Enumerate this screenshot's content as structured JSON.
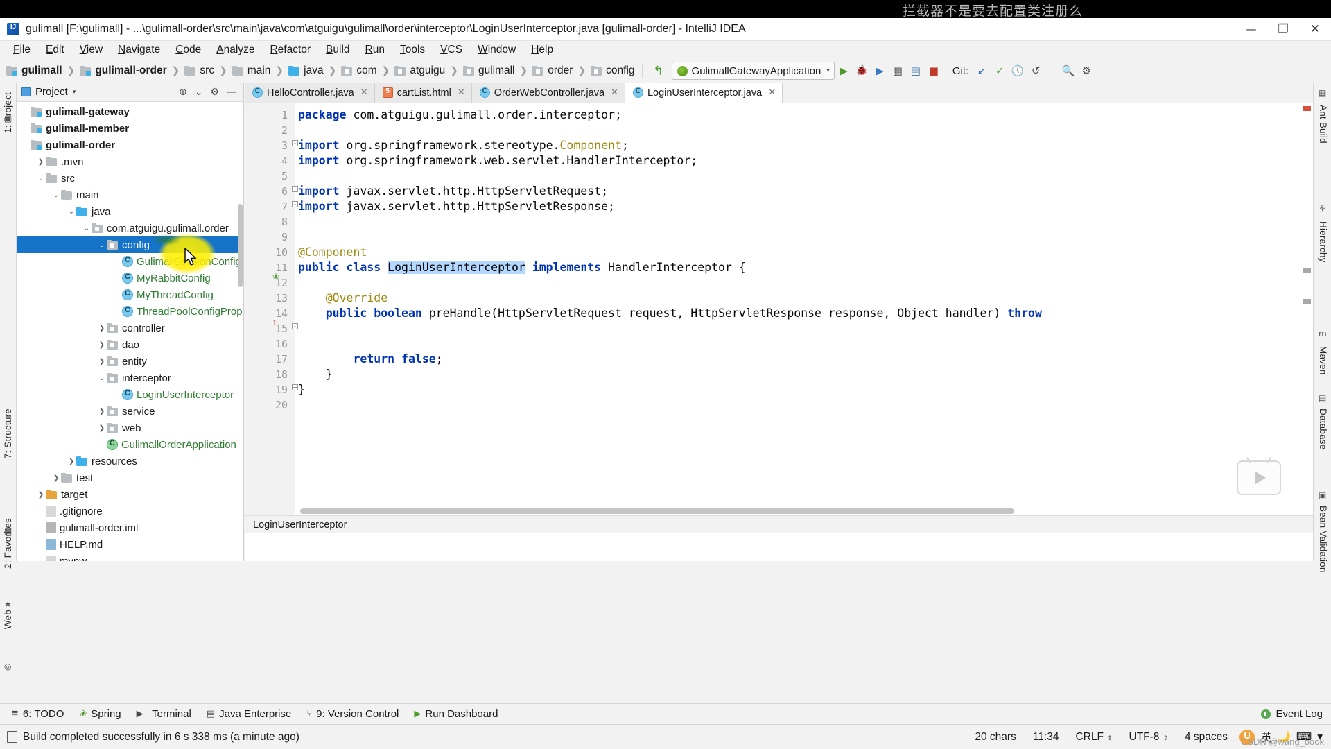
{
  "annotation": {
    "text": "拦截器不是要去配置类注册么"
  },
  "titlebar": {
    "logo_icon": "intellij-idea-logo",
    "title": "gulimall [F:\\gulimall] - ...\\gulimall-order\\src\\main\\java\\com\\atguigu\\gulimall\\order\\interceptor\\LoginUserInterceptor.java [gulimall-order] - IntelliJ IDEA",
    "minimize": "—",
    "maximize": "❐",
    "close": "✕"
  },
  "menubar": {
    "items": [
      "File",
      "Edit",
      "View",
      "Navigate",
      "Code",
      "Analyze",
      "Refactor",
      "Build",
      "Run",
      "Tools",
      "VCS",
      "Window",
      "Help"
    ]
  },
  "navbar": {
    "breadcrumbs": [
      {
        "label": "gulimall",
        "icon": "module-folder-icon",
        "bold": true
      },
      {
        "label": "gulimall-order",
        "icon": "module-folder-icon",
        "bold": true
      },
      {
        "label": "src",
        "icon": "folder-icon",
        "bold": false
      },
      {
        "label": "main",
        "icon": "folder-icon",
        "bold": false
      },
      {
        "label": "java",
        "icon": "source-folder-icon",
        "bold": false
      },
      {
        "label": "com",
        "icon": "package-icon",
        "bold": false
      },
      {
        "label": "atguigu",
        "icon": "package-icon",
        "bold": false
      },
      {
        "label": "gulimall",
        "icon": "package-icon",
        "bold": false
      },
      {
        "label": "order",
        "icon": "package-icon",
        "bold": false
      },
      {
        "label": "config",
        "icon": "package-icon",
        "bold": false
      }
    ],
    "separator": "❯",
    "run_config": {
      "name": "GulimallGatewayApplication",
      "icon": "spring-boot-icon",
      "arrow": "▾"
    },
    "buttons": [
      "run-button",
      "debug-button",
      "run-with-coverage-button",
      "profile-button",
      "build-button",
      "stop-button"
    ],
    "git_label": "Git:"
  },
  "left_strip": {
    "tabs": [
      {
        "label": "1: Project",
        "icon": "project-icon"
      },
      {
        "label": "7: Structure",
        "icon": "structure-icon"
      },
      {
        "label": "2: Favorites",
        "icon": "favorites-icon"
      },
      {
        "label": "Web",
        "icon": "web-icon"
      }
    ]
  },
  "right_strip": {
    "tabs": [
      {
        "label": "Ant Build",
        "icon": "ant-icon"
      },
      {
        "label": "Hierarchy",
        "icon": "hierarchy-icon"
      },
      {
        "label": "Maven",
        "icon": "maven-icon"
      },
      {
        "label": "Database",
        "icon": "database-icon"
      },
      {
        "label": "Bean Validation",
        "icon": "bean-validation-icon"
      }
    ]
  },
  "project_panel": {
    "title": "Project",
    "caret": "▾",
    "icons": [
      "locate-icon",
      "collapse-all-icon",
      "settings-icon",
      "hide-icon"
    ],
    "tree": [
      {
        "label": "gulimall-gateway",
        "indent": 0,
        "arrow": "",
        "icon": "module-folder-icon",
        "bold": true,
        "style": "plain",
        "selected": false
      },
      {
        "label": "gulimall-member",
        "indent": 0,
        "arrow": "",
        "icon": "module-folder-icon",
        "bold": true,
        "style": "plain",
        "selected": false
      },
      {
        "label": "gulimall-order",
        "indent": 0,
        "arrow": "",
        "icon": "module-folder-icon",
        "bold": true,
        "style": "plain",
        "selected": false
      },
      {
        "label": ".mvn",
        "indent": 1,
        "arrow": "❯",
        "icon": "folder-icon",
        "bold": false,
        "style": "plain",
        "selected": false
      },
      {
        "label": "src",
        "indent": 1,
        "arrow": "⌄",
        "icon": "folder-icon",
        "bold": false,
        "style": "plain",
        "selected": false
      },
      {
        "label": "main",
        "indent": 2,
        "arrow": "⌄",
        "icon": "folder-icon",
        "bold": false,
        "style": "plain",
        "selected": false
      },
      {
        "label": "java",
        "indent": 3,
        "arrow": "⌄",
        "icon": "source-folder-icon",
        "bold": false,
        "style": "plain",
        "selected": false
      },
      {
        "label": "com.atguigu.gulimall.order",
        "indent": 4,
        "arrow": "⌄",
        "icon": "package-icon",
        "bold": false,
        "style": "plain",
        "selected": false
      },
      {
        "label": "config",
        "indent": 5,
        "arrow": "⌄",
        "icon": "package-icon",
        "bold": false,
        "style": "plain",
        "selected": true
      },
      {
        "label": "GulimallSessionConfig",
        "indent": 6,
        "arrow": "",
        "icon": "java-class-icon",
        "bold": false,
        "style": "java",
        "selected": false
      },
      {
        "label": "MyRabbitConfig",
        "indent": 6,
        "arrow": "",
        "icon": "java-class-icon",
        "bold": false,
        "style": "java",
        "selected": false
      },
      {
        "label": "MyThreadConfig",
        "indent": 6,
        "arrow": "",
        "icon": "java-class-icon",
        "bold": false,
        "style": "java",
        "selected": false
      },
      {
        "label": "ThreadPoolConfigPrope",
        "indent": 6,
        "arrow": "",
        "icon": "java-class-icon",
        "bold": false,
        "style": "java",
        "selected": false
      },
      {
        "label": "controller",
        "indent": 5,
        "arrow": "❯",
        "icon": "package-icon",
        "bold": false,
        "style": "plain",
        "selected": false
      },
      {
        "label": "dao",
        "indent": 5,
        "arrow": "❯",
        "icon": "package-icon",
        "bold": false,
        "style": "plain",
        "selected": false
      },
      {
        "label": "entity",
        "indent": 5,
        "arrow": "❯",
        "icon": "package-icon",
        "bold": false,
        "style": "plain",
        "selected": false
      },
      {
        "label": "interceptor",
        "indent": 5,
        "arrow": "⌄",
        "icon": "package-icon",
        "bold": false,
        "style": "plain",
        "selected": false
      },
      {
        "label": "LoginUserInterceptor",
        "indent": 6,
        "arrow": "",
        "icon": "java-class-icon",
        "bold": false,
        "style": "java",
        "selected": false
      },
      {
        "label": "service",
        "indent": 5,
        "arrow": "❯",
        "icon": "package-icon",
        "bold": false,
        "style": "plain",
        "selected": false
      },
      {
        "label": "web",
        "indent": 5,
        "arrow": "❯",
        "icon": "package-icon",
        "bold": false,
        "style": "plain",
        "selected": false
      },
      {
        "label": "GulimallOrderApplication",
        "indent": 5,
        "arrow": "",
        "icon": "spring-class-icon",
        "bold": false,
        "style": "java",
        "selected": false
      },
      {
        "label": "resources",
        "indent": 3,
        "arrow": "❯",
        "icon": "resource-folder-icon",
        "bold": false,
        "style": "plain",
        "selected": false
      },
      {
        "label": "test",
        "indent": 2,
        "arrow": "❯",
        "icon": "folder-icon",
        "bold": false,
        "style": "plain",
        "selected": false
      },
      {
        "label": "target",
        "indent": 1,
        "arrow": "❯",
        "icon": "target-folder-icon",
        "bold": false,
        "style": "orange",
        "selected": false
      },
      {
        "label": ".gitignore",
        "indent": 1,
        "arrow": "",
        "icon": "file-icon",
        "bold": false,
        "style": "plain",
        "selected": false
      },
      {
        "label": "gulimall-order.iml",
        "indent": 1,
        "arrow": "",
        "icon": "iml-file-icon",
        "bold": false,
        "style": "plain",
        "selected": false
      },
      {
        "label": "HELP.md",
        "indent": 1,
        "arrow": "",
        "icon": "markdown-file-icon",
        "bold": false,
        "style": "plain",
        "selected": false
      },
      {
        "label": "mvnw",
        "indent": 1,
        "arrow": "",
        "icon": "file-icon",
        "bold": false,
        "style": "plain",
        "selected": false
      }
    ]
  },
  "editor": {
    "tabs": [
      {
        "label": "HelloController.java",
        "icon": "java-class-icon",
        "active": false,
        "close": "✕"
      },
      {
        "label": "cartList.html",
        "icon": "html-file-icon",
        "active": false,
        "close": "✕"
      },
      {
        "label": "OrderWebController.java",
        "icon": "java-class-icon",
        "active": false,
        "close": "✕"
      },
      {
        "label": "LoginUserInterceptor.java",
        "icon": "java-class-icon",
        "active": true,
        "close": "✕"
      }
    ],
    "line_numbers": [
      "1",
      "2",
      "3",
      "4",
      "5",
      "6",
      "7",
      "8",
      "9",
      "10",
      "11",
      "12",
      "13",
      "14",
      "15",
      "16",
      "17",
      "18",
      "19",
      "20"
    ],
    "code_lines": [
      {
        "n": 1,
        "segments": [
          {
            "t": "package ",
            "c": "kw"
          },
          {
            "t": "com.atguigu.gulimall.order.interceptor;",
            "c": "pln"
          }
        ]
      },
      {
        "n": 2,
        "segments": []
      },
      {
        "n": 3,
        "segments": [
          {
            "t": "import ",
            "c": "kw"
          },
          {
            "t": "org.springframework.stereotype.",
            "c": "pln"
          },
          {
            "t": "Component",
            "c": "ann"
          },
          {
            "t": ";",
            "c": "pln"
          }
        ]
      },
      {
        "n": 4,
        "segments": [
          {
            "t": "import ",
            "c": "kw"
          },
          {
            "t": "org.springframework.web.servlet.HandlerInterceptor;",
            "c": "pln"
          }
        ]
      },
      {
        "n": 5,
        "segments": []
      },
      {
        "n": 6,
        "segments": [
          {
            "t": "import ",
            "c": "kw"
          },
          {
            "t": "javax.servlet.http.HttpServletRequest;",
            "c": "pln"
          }
        ]
      },
      {
        "n": 7,
        "segments": [
          {
            "t": "import ",
            "c": "kw"
          },
          {
            "t": "javax.servlet.http.HttpServletResponse;",
            "c": "pln"
          }
        ]
      },
      {
        "n": 8,
        "segments": []
      },
      {
        "n": 9,
        "segments": []
      },
      {
        "n": 10,
        "segments": [
          {
            "t": "@Component",
            "c": "ann"
          }
        ]
      },
      {
        "n": 11,
        "segments": [
          {
            "t": "public ",
            "c": "kw"
          },
          {
            "t": "class ",
            "c": "kw"
          },
          {
            "t": "LoginUserInterceptor",
            "c": "sel"
          },
          {
            "t": " ",
            "c": "pln"
          },
          {
            "t": "implements ",
            "c": "kw"
          },
          {
            "t": "HandlerInterceptor {",
            "c": "pln"
          }
        ]
      },
      {
        "n": 12,
        "segments": []
      },
      {
        "n": 13,
        "segments": [
          {
            "t": "    @Override",
            "c": "ann"
          }
        ]
      },
      {
        "n": 14,
        "segments": [
          {
            "t": "    public ",
            "c": "kw"
          },
          {
            "t": "boolean ",
            "c": "kw"
          },
          {
            "t": "preHandle(HttpServletRequest request, HttpServletResponse response, Object handler) ",
            "c": "pln"
          },
          {
            "t": "throw",
            "c": "kw"
          }
        ]
      },
      {
        "n": 15,
        "segments": []
      },
      {
        "n": 16,
        "segments": []
      },
      {
        "n": 17,
        "segments": [
          {
            "t": "        return ",
            "c": "kw"
          },
          {
            "t": "false",
            "c": "kw"
          },
          {
            "t": ";",
            "c": "pln"
          }
        ]
      },
      {
        "n": 18,
        "segments": [
          {
            "t": "    }",
            "c": "pln"
          }
        ]
      },
      {
        "n": 19,
        "segments": [
          {
            "t": "}",
            "c": "pln"
          }
        ]
      },
      {
        "n": 20,
        "segments": []
      }
    ],
    "footer_breadcrumb": "LoginUserInterceptor"
  },
  "toolwindow_bar": {
    "items": [
      {
        "label": "6: TODO",
        "icon": "todo-icon"
      },
      {
        "label": "Spring",
        "icon": "spring-icon"
      },
      {
        "label": "Terminal",
        "icon": "terminal-icon"
      },
      {
        "label": "Java Enterprise",
        "icon": "java-enterprise-icon"
      },
      {
        "label": "9: Version Control",
        "icon": "version-control-icon"
      },
      {
        "label": "Run Dashboard",
        "icon": "run-dashboard-icon"
      }
    ],
    "event_log": {
      "label": "Event Log",
      "icon": "event-log-icon"
    }
  },
  "statusbar": {
    "message": "Build completed successfully in 6 s 338 ms (a minute ago)",
    "cells": [
      {
        "label": "20 chars",
        "caret": ""
      },
      {
        "label": "11:34",
        "caret": ""
      },
      {
        "label": "CRLF",
        "caret": "⇕"
      },
      {
        "label": "UTF-8",
        "caret": "⇕"
      },
      {
        "label": "4 spaces",
        "caret": ""
      }
    ],
    "ime": {
      "icon": "ime-icon",
      "label": "英"
    },
    "watermark": "CSDN @wang_book"
  },
  "colors": {
    "accent_blue": "#1573c8",
    "panel_bg": "#f2f2f2",
    "editor_bg": "#ffffff",
    "keyword": "#0033b3",
    "annotation": "#9e880d",
    "string": "#067d17",
    "selection": "#b4d7ff",
    "highlight_yellow": "#ffee00",
    "tree_java_green": "#2f7d32"
  }
}
